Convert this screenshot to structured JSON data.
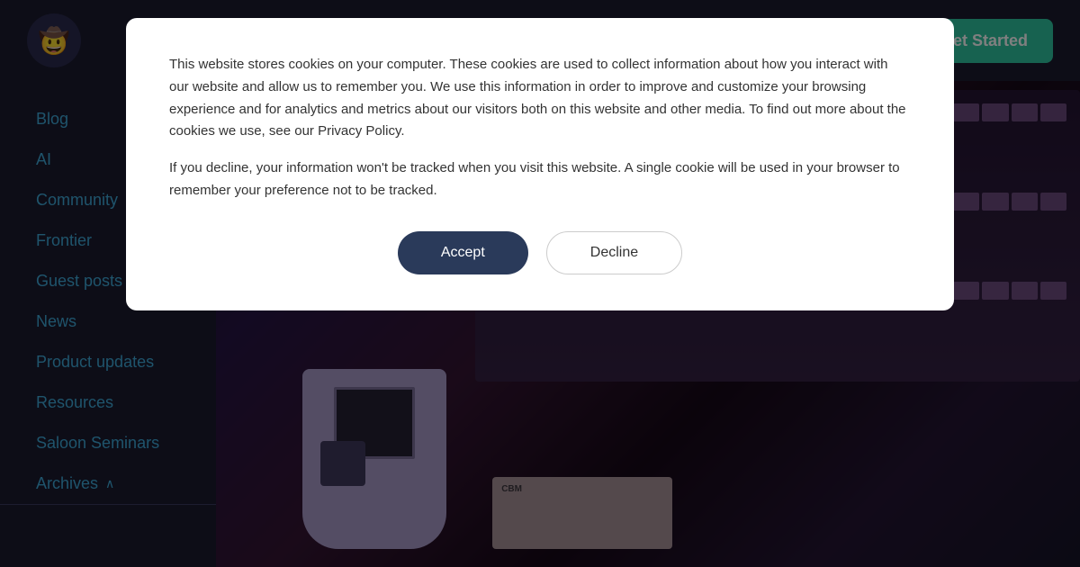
{
  "navbar": {
    "logo_emoji": "🤠",
    "get_started_label": "Get Started"
  },
  "sidebar": {
    "items": [
      {
        "id": "blog",
        "label": "Blog"
      },
      {
        "id": "ai",
        "label": "AI"
      },
      {
        "id": "community",
        "label": "Community"
      },
      {
        "id": "frontier",
        "label": "Frontier"
      },
      {
        "id": "guest-posts",
        "label": "Guest posts"
      },
      {
        "id": "news",
        "label": "News"
      },
      {
        "id": "product-updates",
        "label": "Product updates"
      },
      {
        "id": "resources",
        "label": "Resources"
      },
      {
        "id": "saloon-seminars",
        "label": "Saloon Seminars"
      },
      {
        "id": "archives",
        "label": "Archives"
      }
    ],
    "archives_chevron": "∧"
  },
  "cookie_modal": {
    "body_text_1": "This website stores cookies on your computer. These cookies are used to collect information about how you interact with our website and allow us to remember you. We use this information in order to improve and customize your browsing experience and for analytics and metrics about our visitors both on this website and other media. To find out more about the cookies we use, see our Privacy Policy.",
    "body_text_2": "If you decline, your information won't be tracked when you visit this website. A single cookie will be used in your browser to remember your preference not to be tracked.",
    "privacy_policy_label": "Privacy Policy",
    "accept_label": "Accept",
    "decline_label": "Decline"
  }
}
